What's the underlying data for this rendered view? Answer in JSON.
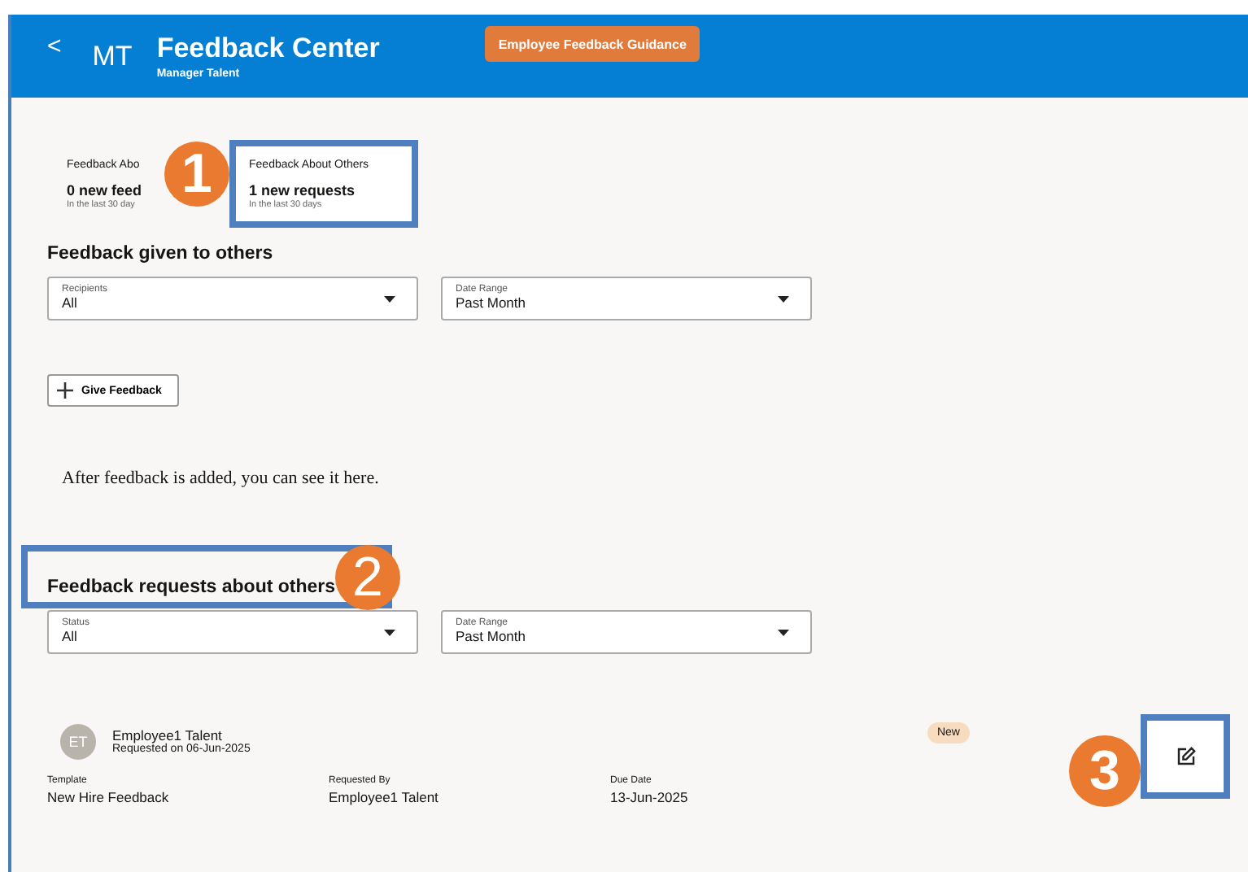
{
  "header": {
    "back": "<",
    "initials": "MT",
    "title": "Feedback Center",
    "subtitle": "Manager Talent",
    "guidance_button": "Employee Feedback Guidance"
  },
  "summary_tiles": [
    {
      "label": "Feedback Abo",
      "count": "0 new feed",
      "period": "In the last 30 day",
      "highlighted": false
    },
    {
      "label": "Feedback About Others",
      "count": "1 new requests",
      "period": "In the last 30 days",
      "highlighted": true
    }
  ],
  "given_section": {
    "heading": "Feedback given to others",
    "filters": [
      {
        "label": "Recipients",
        "value": "All"
      },
      {
        "label": "Date Range",
        "value": "Past Month"
      }
    ],
    "give_button": "Give Feedback",
    "empty_message": "After feedback is added, you can see it here."
  },
  "requests_section": {
    "heading": "Feedback requests about others",
    "filters": [
      {
        "label": "Status",
        "value": "All"
      },
      {
        "label": "Date Range",
        "value": "Past Month"
      }
    ],
    "request": {
      "avatar": "ET",
      "name": "Employee1 Talent",
      "requested_on": "Requested on 06-Jun-2025",
      "badge": "New",
      "fields": [
        {
          "label": "Template",
          "value": "New Hire Feedback"
        },
        {
          "label": "Requested By",
          "value": "Employee1 Talent"
        },
        {
          "label": "Due Date",
          "value": "13-Jun-2025"
        }
      ]
    }
  },
  "callouts": [
    "1",
    "2",
    "3"
  ]
}
